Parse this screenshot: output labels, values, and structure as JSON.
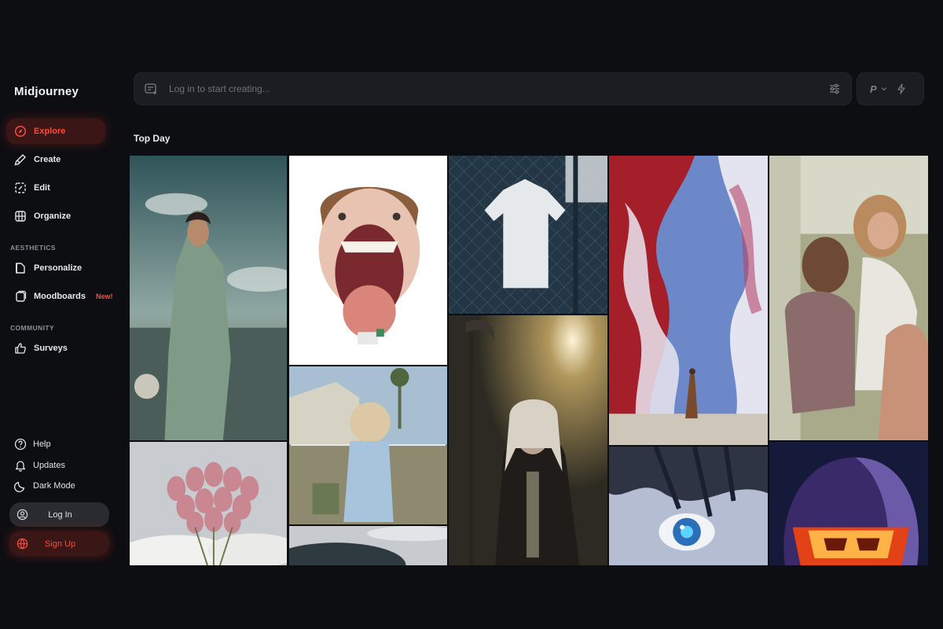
{
  "app": {
    "brand": "Midjourney"
  },
  "sidebar": {
    "primary": [
      {
        "key": "explore",
        "label": "Explore",
        "icon": "compass-icon",
        "active": true
      },
      {
        "key": "create",
        "label": "Create",
        "icon": "paintbrush-icon"
      },
      {
        "key": "edit",
        "label": "Edit",
        "icon": "edit-frame-icon"
      },
      {
        "key": "organize",
        "label": "Organize",
        "icon": "grid-icon"
      }
    ],
    "aesthetics_label": "AESTHETICS",
    "aesthetics": [
      {
        "key": "personalize",
        "label": "Personalize",
        "icon": "palette-book-icon"
      },
      {
        "key": "moodboards",
        "label": "Moodboards",
        "icon": "board-icon",
        "badge": "New!"
      }
    ],
    "community_label": "COMMUNITY",
    "community": [
      {
        "key": "surveys",
        "label": "Surveys",
        "icon": "thumbs-up-icon"
      }
    ],
    "utility": [
      {
        "key": "help",
        "label": "Help",
        "icon": "question-icon"
      },
      {
        "key": "updates",
        "label": "Updates",
        "icon": "bell-icon"
      },
      {
        "key": "dark_mode",
        "label": "Dark Mode",
        "icon": "moon-icon"
      }
    ],
    "login_label": "Log In",
    "signup_label": "Sign Up"
  },
  "search": {
    "placeholder": "Log in to start creating..."
  },
  "mode": {
    "letter": "P"
  },
  "feed": {
    "title": "Top Day"
  },
  "colors": {
    "accent": "#ff4b39",
    "accent_bg": "#3a1616",
    "background": "#0d0e12",
    "panel": "#1c1d22"
  }
}
